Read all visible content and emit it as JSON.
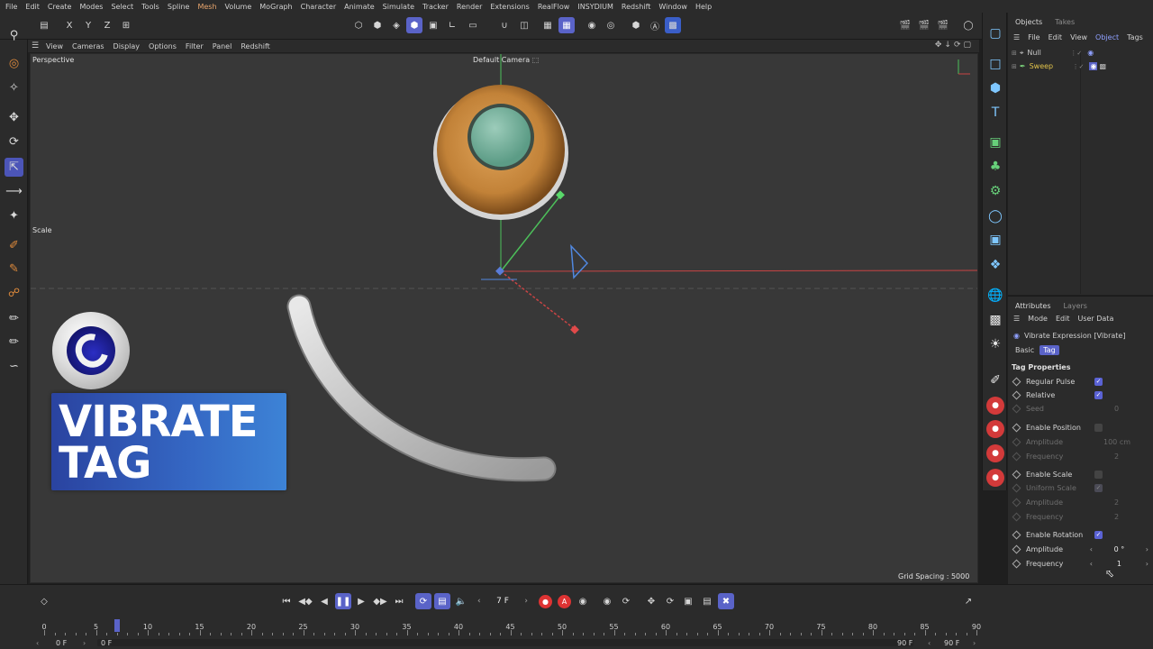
{
  "menubar": [
    "File",
    "Edit",
    "Create",
    "Modes",
    "Select",
    "Tools",
    "Spline",
    "Mesh",
    "Volume",
    "MoGraph",
    "Character",
    "Animate",
    "Simulate",
    "Tracker",
    "Render",
    "Extensions",
    "RealFlow",
    "INSYDIUM",
    "Redshift",
    "Window",
    "Help"
  ],
  "menubar_active_index": 7,
  "viewport_menu": [
    "View",
    "Cameras",
    "Display",
    "Options",
    "Filter",
    "Panel",
    "Redshift"
  ],
  "viewport": {
    "projection": "Perspective",
    "camera": "Default Camera",
    "camera_icon": "⬚",
    "tool_hint": "Scale",
    "grid_spacing": "Grid Spacing : 5000 cm"
  },
  "toolbar": {
    "axis_x": "X",
    "axis_y": "Y",
    "axis_z": "Z"
  },
  "badge": {
    "line1": "VIBRATE",
    "line2": "TAG",
    "color_from": "#2a43a0",
    "color_to": "#3d83d6"
  },
  "objects_panel": {
    "tabs": [
      "Objects",
      "Takes"
    ],
    "menu": [
      "File",
      "Edit",
      "View",
      "Object",
      "Tags"
    ],
    "menu_active_index": 3,
    "items": [
      {
        "name": "Null",
        "color": "#d0d0d0"
      },
      {
        "name": "Sweep",
        "color": "#e0c24a"
      }
    ]
  },
  "attributes_panel": {
    "tabs": [
      "Attributes",
      "Layers"
    ],
    "menu": [
      "Mode",
      "Edit",
      "User Data"
    ],
    "title": "Vibrate Expression [Vibrate]",
    "subtabs": [
      "Basic",
      "Tag"
    ],
    "subtab_active_index": 1,
    "section": "Tag Properties",
    "rows": {
      "regular_pulse": "Regular Pulse",
      "relative": "Relative",
      "seed": "Seed",
      "seed_value": "0",
      "enable_position": "Enable Position",
      "pos_amplitude": "Amplitude",
      "pos_amplitude_value": "100 cm",
      "pos_frequency": "Frequency",
      "pos_frequency_value": "2",
      "enable_scale": "Enable Scale",
      "uniform_scale": "Uniform Scale",
      "scale_amplitude": "Amplitude",
      "scale_amplitude_value": "2",
      "scale_frequency": "Frequency",
      "scale_frequency_value": "2",
      "enable_rotation": "Enable Rotation",
      "rot_amplitude": "Amplitude",
      "rot_amplitude_value": "0 °",
      "rot_frequency": "Frequency",
      "rot_frequency_value": "1"
    }
  },
  "timeline": {
    "current_frame": "7 F",
    "start_frame": "0 F",
    "range_start": "0 F",
    "range_end": "90 F",
    "end_frame": "90 F",
    "ticks": [
      "0",
      "5",
      "10",
      "15",
      "20",
      "25",
      "30",
      "35",
      "40",
      "45",
      "50",
      "55",
      "60",
      "65",
      "70",
      "75",
      "80",
      "85",
      "90"
    ],
    "max_frame": 90,
    "playhead_frame": 7
  },
  "colors": {
    "accent": "#5a63c8",
    "viewport_bg": "#383838",
    "panel_bg": "#2b2b2b"
  }
}
